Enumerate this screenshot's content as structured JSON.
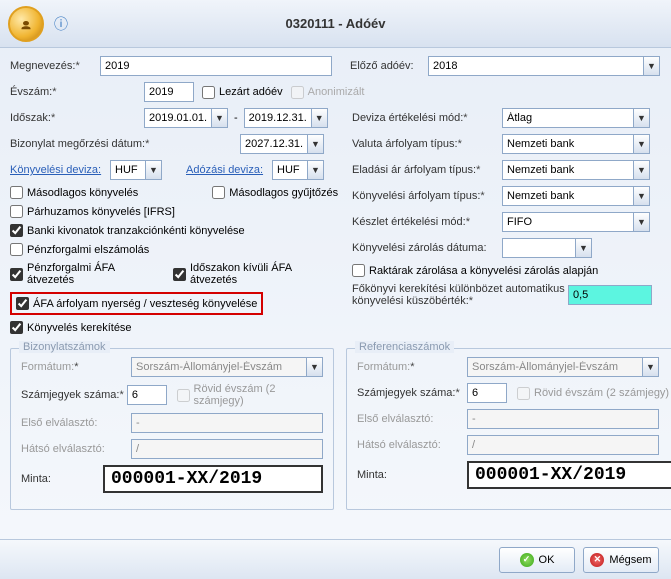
{
  "header": {
    "title": "0320111 - Adóév"
  },
  "left": {
    "megnevezes_lbl": "Megnevezés:",
    "megnevezes": "2019",
    "evszam_lbl": "Évszám:",
    "evszam": "2019",
    "lezart_lbl": "Lezárt adóév",
    "anonimizalt_lbl": "Anonimizált",
    "idoszak_lbl": "Időszak:",
    "idoszak_tol": "2019.01.01.",
    "idoszak_ig": "2019.12.31.",
    "bizonylat_lbl": "Bizonylat megőrzési dátum:",
    "bizonylat_val": "2027.12.31.",
    "konyv_deviza_lbl": "Könyvelési deviza:",
    "konyv_deviza": "HUF",
    "adozasi_deviza_lbl": "Adózási deviza:",
    "adozasi_deviza": "HUF",
    "masodlagos_konyv": "Másodlagos könyvelés",
    "masodlagos_gyujtozes": "Másodlagos gyűjtőzés",
    "parhuzamos": "Párhuzamos könyvelés [IFRS]",
    "banki_kivonatok": "Banki kivonatok tranzakciónkénti könyvelése",
    "penzforgalmi_elsz": "Pénzforgalmi elszámolás",
    "penzforgalmi_afa": "Pénzforgalmi ÁFA átvezetés",
    "idoszakon_kivuli": "Időszakon kívüli ÁFA átvezetés",
    "afa_arfolyam": "ÁFA árfolyam nyerség / veszteség könyvelése",
    "konyveles_kerekitese": "Könyvelés kerekítése"
  },
  "right": {
    "elozo_adoev_lbl": "Előző adóév:",
    "elozo_adoev": "2018",
    "deviza_ert_lbl": "Deviza értékelési mód:",
    "deviza_ert": "Átlag",
    "valuta_arf_lbl": "Valuta árfolyam típus:",
    "valuta_arf": "Nemzeti bank",
    "eladasi_ar_lbl": "Eladási ár árfolyam típus:",
    "eladasi_ar": "Nemzeti bank",
    "konyvelesi_arf_lbl": "Könyvelési árfolyam típus:",
    "konyvelesi_arf": "Nemzeti bank",
    "keszlet_ert_lbl": "Készlet értékelési mód:",
    "keszlet_ert": "FIFO",
    "konyv_zar_lbl": "Könyvelési zárolás dátuma:",
    "konyv_zar": "",
    "raktarak_zar": "Raktárak zárolása a könyvelési zárolás alapján",
    "fokonyvi_lbl": "Főkönyvi kerekítési különbözet automatikus könyvelési küszöbérték:",
    "fokonyvi_val": "0,5"
  },
  "bizszam": {
    "legend": "Bizonylatszámok",
    "formatum_lbl": "Formátum:",
    "formatum": "Sorszám-Állományjel-Évszám",
    "szamjegy_lbl": "Számjegyek száma:",
    "szamjegy": "6",
    "rovid_ev": "Rövid évszám (2 számjegy)",
    "elso_elv_lbl": "Első elválasztó:",
    "elso_elv": "-",
    "hatso_elv_lbl": "Hátsó elválasztó:",
    "hatso_elv": "/",
    "minta_lbl": "Minta:",
    "minta": "000001-XX/2019"
  },
  "refszam": {
    "legend": "Referenciaszámok",
    "formatum_lbl": "Formátum:",
    "formatum": "Sorszám-Állományjel-Évszám",
    "szamjegy_lbl": "Számjegyek száma:",
    "szamjegy": "6",
    "rovid_ev": "Rövid évszám (2 számjegy)",
    "elso_elv_lbl": "Első elválasztó:",
    "elso_elv": "-",
    "hatso_elv_lbl": "Hátsó elválasztó:",
    "hatso_elv": "/",
    "minta_lbl": "Minta:",
    "minta": "000001-XX/2019"
  },
  "footer": {
    "ok": "OK",
    "cancel": "Mégsem"
  }
}
